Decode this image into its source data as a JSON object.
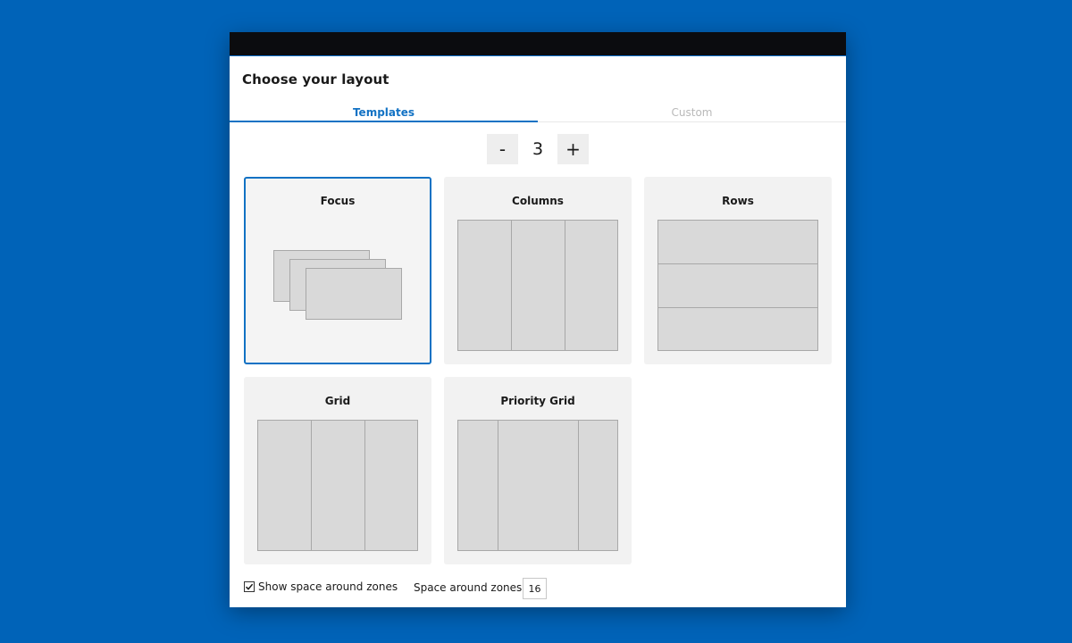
{
  "dialog": {
    "title": "Choose your layout"
  },
  "tabs": [
    {
      "label": "Templates",
      "active": true
    },
    {
      "label": "Custom",
      "active": false
    }
  ],
  "zone_stepper": {
    "decrement_label": "-",
    "value": "3",
    "increment_label": "+"
  },
  "templates": [
    {
      "label": "Focus",
      "selected": true
    },
    {
      "label": "Columns",
      "selected": false
    },
    {
      "label": "Rows",
      "selected": false
    },
    {
      "label": "Grid",
      "selected": false
    },
    {
      "label": "Priority Grid",
      "selected": false
    }
  ],
  "options": {
    "show_space_label": "Show space around zones",
    "show_space_checked": true,
    "space_around_label": "Space around zones",
    "space_around_value": "16"
  },
  "colors": {
    "desktop_background": "#0063b8",
    "accent": "#1272c4",
    "titlebar": "#0b0c0f",
    "card_background": "#f2f2f2",
    "zone_fill": "#d9d9d9",
    "zone_border": "#a8a8a8"
  }
}
